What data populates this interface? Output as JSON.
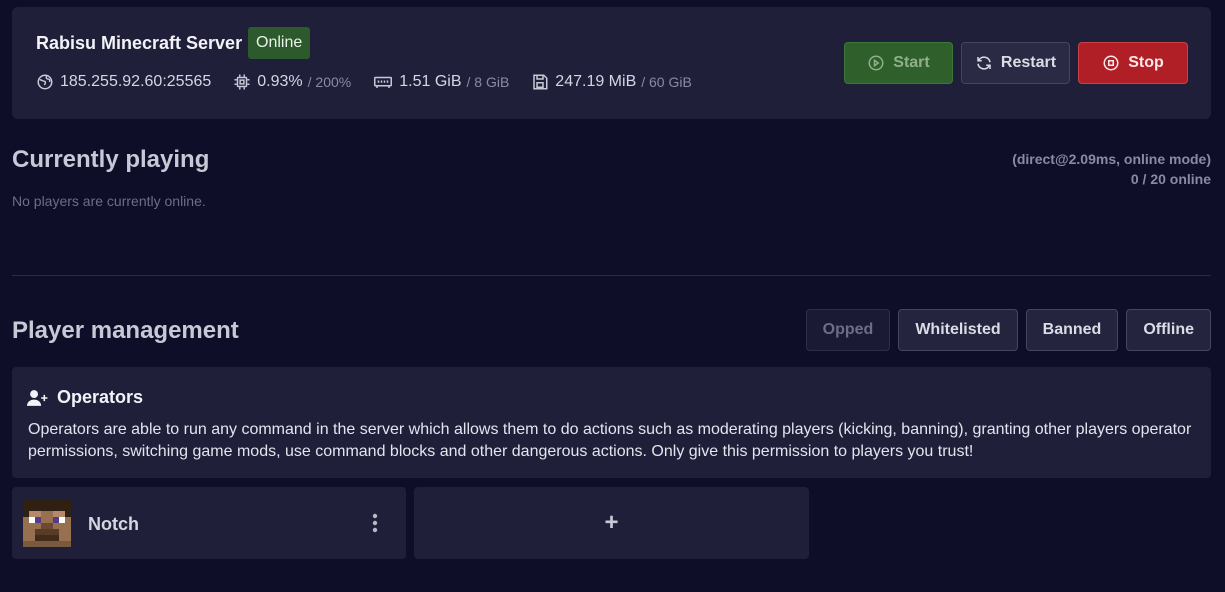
{
  "server": {
    "name": "Rabisu Minecraft Server",
    "status": "Online",
    "address": "185.255.92.60:25565",
    "cpu": "0.93%",
    "cpu_limit": "/ 200%",
    "memory": "1.51 GiB",
    "memory_limit": "/ 8 GiB",
    "disk": "247.19 MiB",
    "disk_limit": "/ 60 GiB"
  },
  "actions": {
    "start": "Start",
    "restart": "Restart",
    "stop": "Stop"
  },
  "playing": {
    "title": "Currently playing",
    "empty": "No players are currently online.",
    "ping": "(direct@2.09ms, online mode)",
    "count": "0 / 20 online"
  },
  "management": {
    "title": "Player management",
    "tabs": [
      "Opped",
      "Whitelisted",
      "Banned",
      "Offline"
    ]
  },
  "operators": {
    "title": "Operators",
    "description": "Operators are able to run any command in the server which allows them to do actions such as moderating players (kicking, banning), granting other players operator permissions, switching game mods, use command blocks and other dangerous actions. Only give this permission to players you trust!"
  },
  "players": [
    {
      "name": "Notch"
    }
  ],
  "add_label": "+",
  "colors": {
    "accent_stop": "#b01f25",
    "accent_start": "#2f5f2b",
    "status_online": "#2c5a2c"
  }
}
